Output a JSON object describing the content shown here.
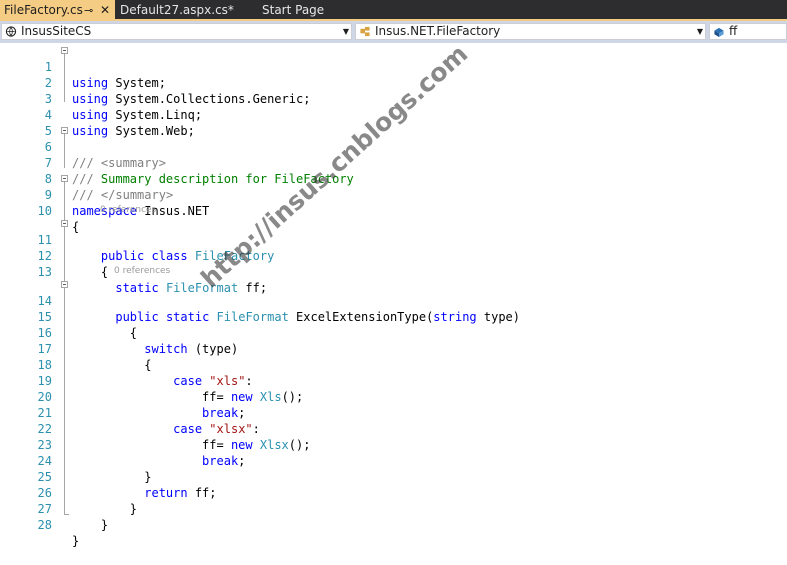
{
  "tabs": [
    {
      "label": "FileFactory.cs",
      "active": true,
      "pin_icon": "pin-icon",
      "close_icon": "close-icon"
    },
    {
      "label": "Default27.aspx.cs*",
      "active": false
    },
    {
      "label": "Start Page",
      "active": false
    }
  ],
  "navbar": {
    "project": "InsusSiteCS",
    "project_icon": "csharp-project-icon",
    "type_scope": "Insus.NET.FileFactory",
    "type_icon": "class-icon",
    "member": "ff",
    "member_icon": "field-icon"
  },
  "references": {
    "class": "0 references",
    "method": "0 references"
  },
  "lines": [
    {
      "n": "1",
      "text": "using System;"
    },
    {
      "n": "2",
      "text": "using System.Collections.Generic;"
    },
    {
      "n": "3",
      "text": "using System.Linq;"
    },
    {
      "n": "4",
      "text": "using System.Web;"
    },
    {
      "n": "5",
      "text": ""
    },
    {
      "n": "6",
      "text": "/// <summary>"
    },
    {
      "n": "7",
      "text": "/// Summary description for FileFactory"
    },
    {
      "n": "8",
      "text": "/// </summary>"
    },
    {
      "n": "9",
      "text": "namespace Insus.NET"
    },
    {
      "n": "10",
      "text": "{"
    },
    {
      "n": "11",
      "text": "    public class FileFactory"
    },
    {
      "n": "12",
      "text": "    {"
    },
    {
      "n": "13",
      "text": "      static FileFormat ff;"
    },
    {
      "n": "14",
      "text": "      public static FileFormat ExcelExtensionType(string type)"
    },
    {
      "n": "15",
      "text": "        {"
    },
    {
      "n": "16",
      "text": "          switch (type)"
    },
    {
      "n": "17",
      "text": "          {"
    },
    {
      "n": "18",
      "text": "              case \"xls\":"
    },
    {
      "n": "19",
      "text": "                  ff= new Xls();"
    },
    {
      "n": "20",
      "text": "                  break;"
    },
    {
      "n": "21",
      "text": "              case \"xlsx\":"
    },
    {
      "n": "22",
      "text": "                  ff= new Xlsx();"
    },
    {
      "n": "23",
      "text": "                  break;"
    },
    {
      "n": "24",
      "text": "          }"
    },
    {
      "n": "25",
      "text": "          return ff;"
    },
    {
      "n": "26",
      "text": "        }"
    },
    {
      "n": "27",
      "text": "    }"
    },
    {
      "n": "28",
      "text": "}"
    }
  ],
  "watermark": "http://insus.cnblogs.com",
  "colors": {
    "active_tab": "#f5cc84",
    "tab_strip": "#2d2d30",
    "navbar": "#cfd6e5",
    "keyword": "#0000ff",
    "type": "#2b91af",
    "comment": "#008000",
    "string": "#a31515",
    "line_number": "#2b91af"
  }
}
